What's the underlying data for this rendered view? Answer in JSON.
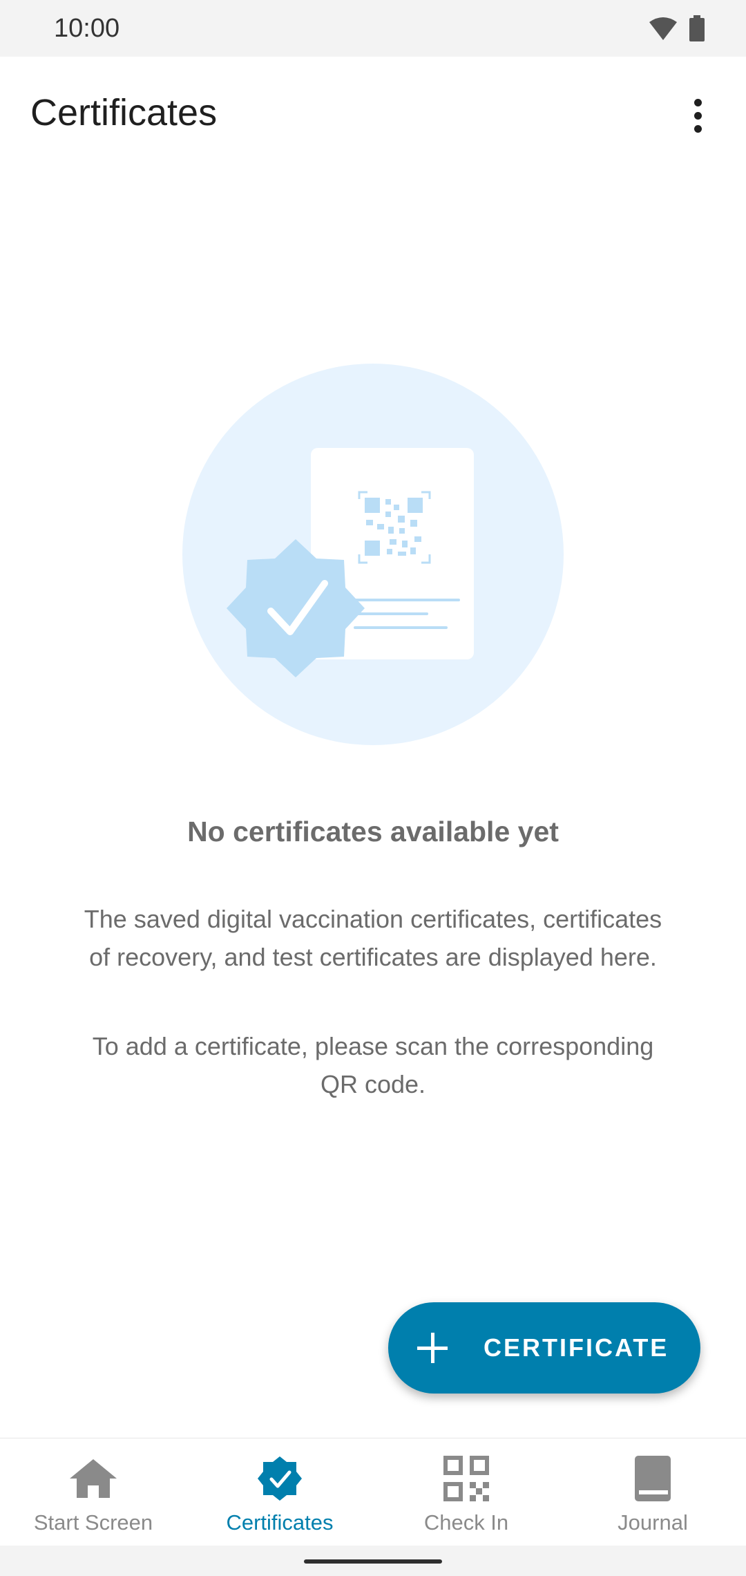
{
  "status_bar": {
    "time": "10:00",
    "icons": [
      "wifi-icon",
      "battery-icon"
    ]
  },
  "app_bar": {
    "title": "Certificates",
    "menu_icon": "more-vert-icon"
  },
  "empty_state": {
    "title": "No certificates available yet",
    "description": "The saved digital vaccination certificates, certificates of recovery, and test certificates are displayed here.",
    "hint": "To add a certificate, please scan the corresponding QR code."
  },
  "fab": {
    "label": "CERTIFICATE",
    "icon": "plus-icon"
  },
  "bottom_nav": {
    "items": [
      {
        "label": "Start Screen",
        "icon": "home-icon",
        "active": false
      },
      {
        "label": "Certificates",
        "icon": "verified-badge-icon",
        "active": true
      },
      {
        "label": "Check In",
        "icon": "qr-code-icon",
        "active": false
      },
      {
        "label": "Journal",
        "icon": "book-icon",
        "active": false
      }
    ]
  },
  "colors": {
    "accent": "#007fad",
    "illustration_bg": "#e7f3fe",
    "illustration_fg": "#b9ddf6"
  }
}
